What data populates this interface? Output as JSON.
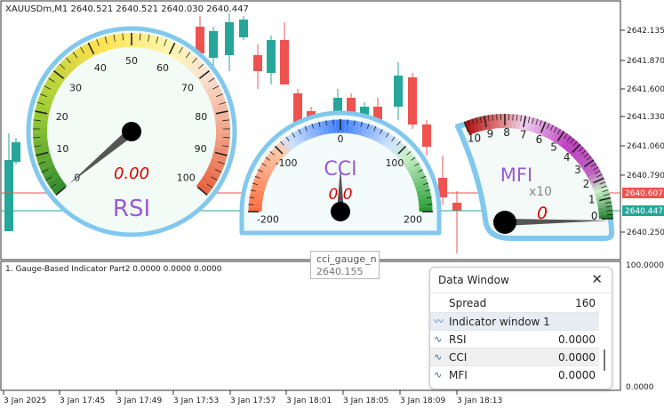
{
  "chart": {
    "title": "XAUUSDm,M1  2640.521 2640.521 2640.030 2640.447",
    "price_labels": [
      "2642.135",
      "2641.870",
      "2641.600",
      "2641.330",
      "2641.060",
      "2640.790",
      "2640.250"
    ],
    "current_prices": {
      "bid_label": "2640.607",
      "ask_label": "2640.447",
      "bid_color": "#ef5350",
      "ask_color": "#26a69a"
    },
    "time_labels": [
      "3 Jan 2025",
      "3 Jan 17:45",
      "3 Jan 17:49",
      "3 Jan 17:53",
      "3 Jan 17:57",
      "3 Jan 18:01",
      "3 Jan 18:05",
      "3 Jan 18:09",
      "3 Jan 18:13"
    ],
    "colors": {
      "bull": "#26a69a",
      "bear": "#ef5350"
    }
  },
  "subwindow": {
    "label": "1. Gauge-Based Indicator Part2 0.0000 0.0000 0.0000",
    "scale_top": "100.0000",
    "scale_bottom": "0.0000"
  },
  "gauges": {
    "rsi": {
      "name": "RSI",
      "value_text": "0.00",
      "ticks": [
        "0",
        "10",
        "20",
        "30",
        "40",
        "50",
        "60",
        "70",
        "80",
        "90",
        "100"
      ],
      "value": 0
    },
    "cci": {
      "name": "CCI",
      "value_text": "0.0",
      "ticks": [
        "-200",
        "-100",
        "0",
        "100",
        "200"
      ],
      "value": 0
    },
    "mfi": {
      "name": "MFI",
      "value_text": "0",
      "multiplier": "x10",
      "ticks": [
        "10",
        "9",
        "8",
        "7",
        "6",
        "5",
        "4",
        "3",
        "2",
        "1",
        "0"
      ],
      "value": 0
    }
  },
  "tooltip": {
    "line1": "cci_gauge_n",
    "line2": "2640.155"
  },
  "data_window": {
    "title": "Data Window",
    "spread_label": "Spread",
    "spread_value": "160",
    "group_label": "Indicator window 1",
    "rows": [
      {
        "label": "RSI",
        "value": "0.0000"
      },
      {
        "label": "CCI",
        "value": "0.0000"
      },
      {
        "label": "MFI",
        "value": "0.0000"
      }
    ]
  }
}
